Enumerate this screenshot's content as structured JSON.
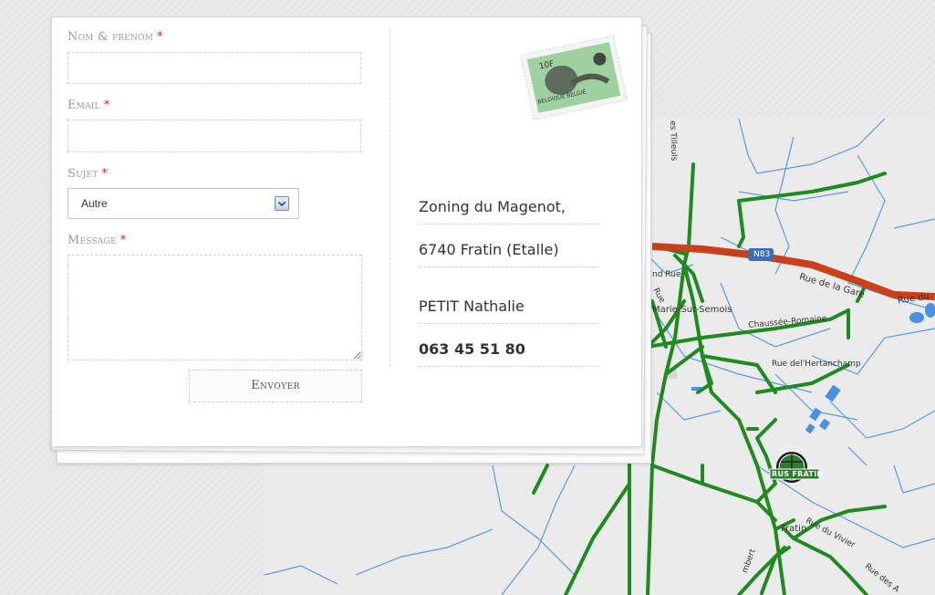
{
  "form": {
    "name_label": "Nom & prenom",
    "email_label": "Email",
    "subject_label": "Sujet",
    "message_label": "Message",
    "required_mark": "*",
    "name_value": "",
    "email_value": "",
    "subject_value": "Autre",
    "message_value": "",
    "submit_label": "Envoyer"
  },
  "address": {
    "line1": "Zoning du Magenot,",
    "line2": "6740 Fratin (Etalle)",
    "contact": "PETIT Nathalie",
    "phone": "063 45 51 80"
  },
  "stamp": {
    "value": "10F",
    "country": "BELGIQUE BELGIË"
  },
  "map": {
    "labels": {
      "road_n83": "N83",
      "rue_gare": "Rue de la Gare",
      "rue_du": "Rue du",
      "chaussee_romaine": "Chaussée-Romaine",
      "rue_hertanchamp": "Rue del'Hertanchamp",
      "marie_sur_semois": "Marie-Sur-Semois",
      "fratin": "Fratin",
      "rue_vivier": "Rue du Vivier",
      "rue_des_a": "Rue des A",
      "tilleuls": "es Tilleuls",
      "and_rue": "nd Rue",
      "rue_small": "Rue",
      "ambert": "mbert",
      "marker": "RUS FRATIN"
    }
  },
  "colors": {
    "road_green": "#1f8a1f",
    "road_red": "#c8411b",
    "water_blue": "#4a90e2",
    "required_red": "#cc2222"
  }
}
